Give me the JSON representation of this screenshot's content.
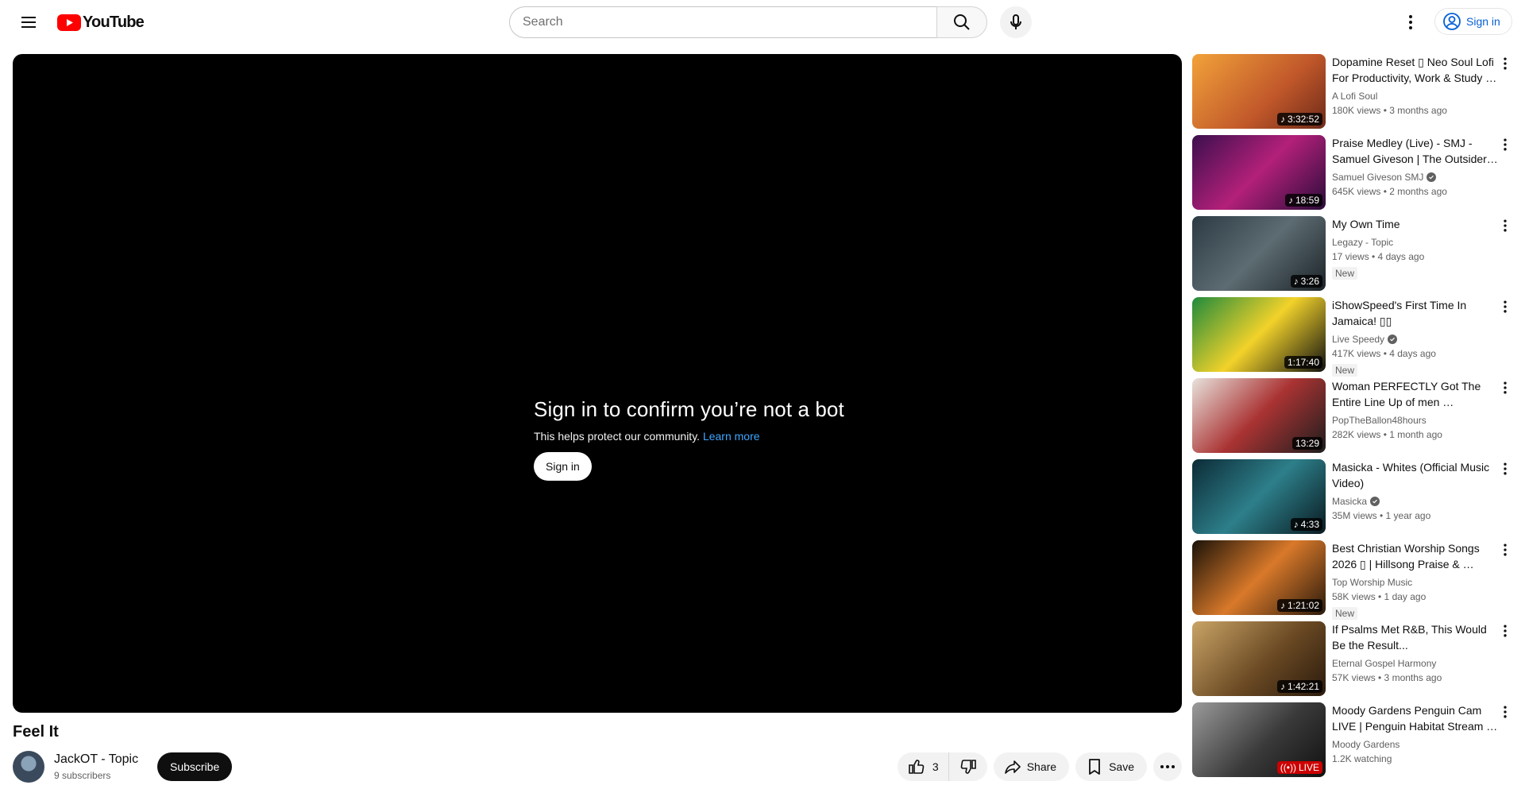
{
  "header": {
    "logo_text": "YouTube",
    "search_placeholder": "Search",
    "signin_label": "Sign in"
  },
  "player": {
    "title": "Sign in to confirm you’re not a bot",
    "subtitle": "This helps protect our community.",
    "learn_more": "Learn more",
    "signin_label": "Sign in"
  },
  "video": {
    "title": "Feel It",
    "channel": "JackOT - Topic",
    "subscribers": "9 subscribers",
    "subscribe_label": "Subscribe",
    "likes": "3",
    "share_label": "Share",
    "save_label": "Save"
  },
  "colors": {
    "brand_red": "#ff0000",
    "link_blue": "#065fd4",
    "dark_link": "#3ea6ff"
  },
  "recommendations": [
    {
      "title": "Dopamine Reset ▯ Neo Soul Lofi For Productivity, Work & Study …",
      "channel": "A Lofi Soul",
      "verified": false,
      "stats": "180K views • 3 months ago",
      "duration": "3:32:52",
      "music": true,
      "new": "",
      "live": false,
      "thumb": "linear-gradient(135deg,#f2a23a,#c0572a 60%,#6d2a19)"
    },
    {
      "title": "Praise Medley (Live) - SMJ - Samuel Giveson | The Outsider…",
      "channel": "Samuel Giveson SMJ",
      "verified": true,
      "stats": "645K views • 2 months ago",
      "duration": "18:59",
      "music": true,
      "new": "",
      "live": false,
      "thumb": "linear-gradient(135deg,#3b0f4d,#b3207a 50%,#2a0c3a)"
    },
    {
      "title": "My Own Time",
      "channel": "Legazy - Topic",
      "verified": false,
      "stats": "17 views • 4 days ago",
      "duration": "3:26",
      "music": true,
      "new": "New",
      "live": false,
      "thumb": "linear-gradient(135deg,#2c3a44,#5d6c72 50%,#1b2328)"
    },
    {
      "title": "iShowSpeed's First Time In Jamaica! ▯▯",
      "channel": "Live Speedy",
      "verified": true,
      "stats": "417K views • 4 days ago",
      "duration": "1:17:40",
      "music": false,
      "new": "New",
      "live": false,
      "thumb": "linear-gradient(135deg,#1f8a3c,#f2d22a 50%,#111)"
    },
    {
      "title": "Woman PERFECTLY Got The Entire Line Up of men …",
      "channel": "PopTheBallon48hours",
      "verified": false,
      "stats": "282K views • 1 month ago",
      "duration": "13:29",
      "music": false,
      "new": "",
      "live": false,
      "thumb": "linear-gradient(135deg,#e8e2dc,#a33 50%,#1d1d1d)"
    },
    {
      "title": "Masicka - Whites (Official Music Video)",
      "channel": "Masicka",
      "verified": true,
      "stats": "35M views • 1 year ago",
      "duration": "4:33",
      "music": true,
      "new": "",
      "live": false,
      "thumb": "linear-gradient(135deg,#0c2b36,#2d7f8a 50%,#0a1a20)"
    },
    {
      "title": "Best Christian Worship Songs 2026 ▯ | Hillsong Praise & …",
      "channel": "Top Worship Music",
      "verified": false,
      "stats": "58K views • 1 day ago",
      "duration": "1:21:02",
      "music": true,
      "new": "New",
      "live": false,
      "thumb": "linear-gradient(135deg,#1a1208,#d9792a 50%,#2a1a0c)"
    },
    {
      "title": "If Psalms Met R&B, This Would Be the Result...",
      "channel": "Eternal Gospel Harmony",
      "verified": false,
      "stats": "57K views • 3 months ago",
      "duration": "1:42:21",
      "music": true,
      "new": "",
      "live": false,
      "thumb": "linear-gradient(135deg,#c9a466,#6b4a24 55%,#2a1a0c)"
    },
    {
      "title": "Moody Gardens Penguin Cam LIVE | Penguin Habitat Stream …",
      "channel": "Moody Gardens",
      "verified": false,
      "stats": "1.2K watching",
      "duration": "LIVE",
      "music": false,
      "new": "",
      "live": true,
      "thumb": "linear-gradient(135deg,#9a9a9a,#3a3a3a 55%,#111)"
    }
  ]
}
